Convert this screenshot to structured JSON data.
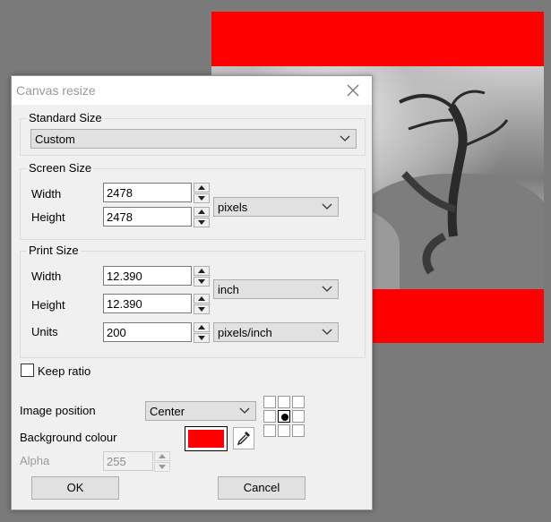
{
  "dialog": {
    "title": "Canvas resize",
    "standard_size": {
      "group_label": "Standard Size",
      "selected": "Custom"
    },
    "screen_size": {
      "group_label": "Screen Size",
      "width_label": "Width",
      "width_value": "2478",
      "height_label": "Height",
      "height_value": "2478",
      "unit": "pixels"
    },
    "print_size": {
      "group_label": "Print Size",
      "width_label": "Width",
      "width_value": "12.390",
      "height_label": "Height",
      "height_value": "12.390",
      "height_unit": "inch",
      "units_label": "Units",
      "units_value": "200",
      "units_unit": "pixels/inch"
    },
    "keep_ratio": {
      "label": "Keep ratio",
      "checked": false
    },
    "image_position": {
      "label": "Image position",
      "selected": "Center"
    },
    "background_colour": {
      "label": "Background colour",
      "color": "#ff0000"
    },
    "alpha": {
      "label": "Alpha",
      "value": "255"
    },
    "ok_label": "OK",
    "cancel_label": "Cancel"
  },
  "canvas": {
    "border_color": "#ff0000"
  },
  "icons": {
    "close": "close-icon",
    "chevron": "chevron-down-icon",
    "spin_up": "arrow-up-icon",
    "spin_down": "arrow-down-icon",
    "eyedropper": "eyedropper-icon"
  }
}
